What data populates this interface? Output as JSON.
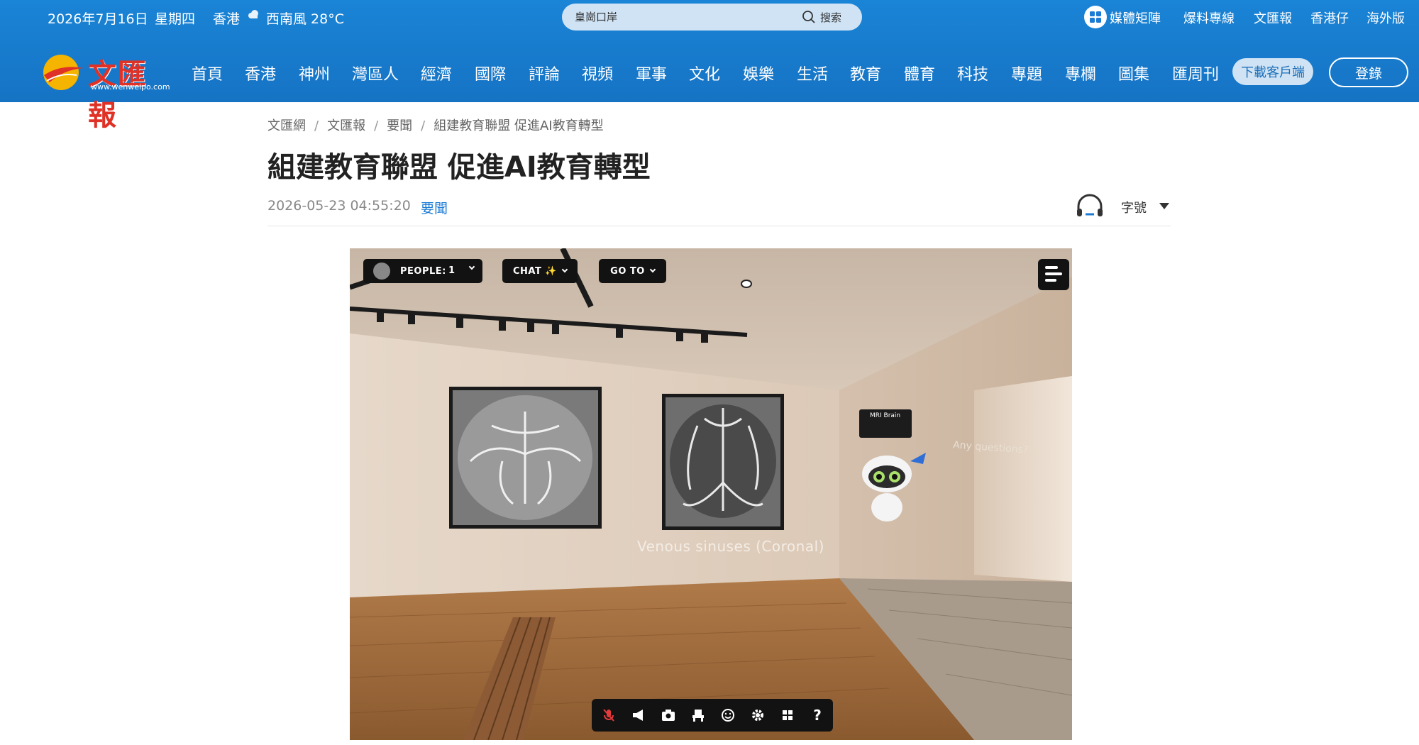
{
  "topbar": {
    "date": "2026年7月16日",
    "weekday": "星期四",
    "city": "香港",
    "weather": "西南風 28°C",
    "search_placeholder": "皇崗口岸",
    "search_button": "搜索",
    "links": [
      "媒體矩陣",
      "爆料專線",
      "文匯報",
      "香港仔",
      "海外版"
    ]
  },
  "logo": {
    "text": "文匯報",
    "url": "www.wenweipo.com"
  },
  "nav": {
    "items": [
      "首頁",
      "香港",
      "神州",
      "灣區人",
      "經濟",
      "國際",
      "評論",
      "視頻",
      "軍事",
      "文化",
      "娛樂",
      "生活",
      "教育",
      "體育",
      "科技",
      "專題",
      "專欄",
      "圖集",
      "匯周刊"
    ],
    "download": "下載客戶端",
    "login": "登錄"
  },
  "article": {
    "breadcrumb": [
      "文匯網",
      "文匯報",
      "要聞",
      "組建教育聯盟 促進AI教育轉型"
    ],
    "title": "組建教育聯盟 促進AI教育轉型",
    "time": "2026-05-23 04:55:20",
    "category": "要聞",
    "font_size_label": "字號"
  },
  "scene": {
    "people_label": "PEOPLE:",
    "people_count": "1",
    "chat_label": "CHAT ✨",
    "goto_label": "GO TO",
    "caption": "Venous sinuses (Coronal)",
    "any_questions": "Any questions?",
    "board_label": "MRI Brain",
    "toolbar_icons": [
      "mic-muted-icon",
      "megaphone-icon",
      "camera-icon",
      "seat-icon",
      "emoji-icon",
      "settings-icon",
      "grid-icon",
      "help-icon"
    ]
  },
  "colors": {
    "header_blue": "#1673c4",
    "link_blue": "#1a7ad4",
    "logo_red": "#e03127"
  }
}
